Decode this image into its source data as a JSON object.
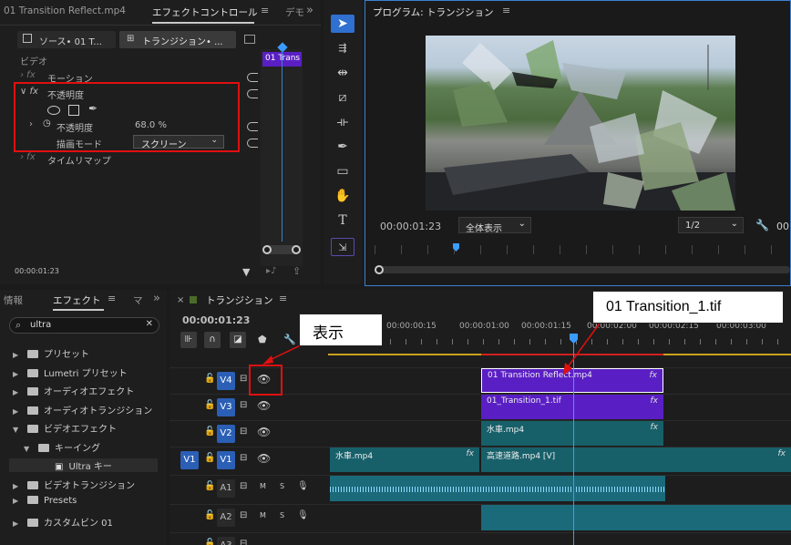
{
  "colors": {
    "accent": "#3b9cff",
    "clip_purple": "#5a1fc4",
    "clip_teal": "#17606a",
    "highlight": "#e01010"
  },
  "topbar": {
    "source_tab": "01 Transition Reflect.mp4",
    "effect_controls_tab": "エフェクトコントロール",
    "extra_tab": "デモ",
    "overflow": "»",
    "program_tab": "プログラム: トランジション"
  },
  "effect_controls": {
    "source_chip": "ソース• 01 T...",
    "sequence_chip": "トランジション• ...",
    "section_video": "ビデオ",
    "clip_label": "01 Trans",
    "motion": "モーション",
    "opacity": "不透明度",
    "opacity_prop": "不透明度",
    "opacity_value": "68.0 %",
    "blend_mode_label": "描画モード",
    "blend_mode_value": "スクリーン",
    "time_remap": "タイムリマップ",
    "timecode": "00:00:01:23",
    "fx_icon": "fx-icon"
  },
  "tools": [
    "selection-tool-icon",
    "track-select-icon",
    "ripple-edit-icon",
    "razor-tool-icon",
    "slip-tool-icon",
    "pen-tool-icon",
    "rectangle-tool-icon",
    "hand-tool-icon",
    "type-tool-icon",
    "motion-tool-icon"
  ],
  "program": {
    "timecode": "00:00:01:23",
    "zoom_value": "全体表示",
    "resolution_value": "1/2",
    "timecode_right": "00"
  },
  "project_panel": {
    "tab_info": "情報",
    "tab_effects": "エフェクト",
    "tab_more": "マ",
    "overflow": "»",
    "search_value": "ultra",
    "bins": [
      {
        "label": "プリセット",
        "indent": 0,
        "open": false
      },
      {
        "label": "Lumetri プリセット",
        "indent": 0,
        "open": false
      },
      {
        "label": "オーディオエフェクト",
        "indent": 0,
        "open": false
      },
      {
        "label": "オーディオトランジション",
        "indent": 0,
        "open": false
      },
      {
        "label": "ビデオエフェクト",
        "indent": 0,
        "open": true
      },
      {
        "label": "キーイング",
        "indent": 1,
        "open": true
      },
      {
        "label": "Ultra キー",
        "indent": 2,
        "open": false
      },
      {
        "label": "ビデオトランジション",
        "indent": 0,
        "open": false
      },
      {
        "label": "Presets",
        "indent": 0,
        "open": false
      },
      {
        "label": "カスタムビン 01",
        "indent": 0,
        "open": false
      }
    ]
  },
  "timeline": {
    "tab": "トランジション",
    "timecode": "00:00:01:23",
    "ruler": [
      "00:00:00:15",
      "00:00:01:00",
      "00:00:01:15",
      "00:00:02:00",
      "00:00:02:15",
      "00:00:03:00"
    ],
    "tracks": [
      {
        "name": "V4",
        "clips": [
          {
            "label": "01 Transition Reflect.mp4",
            "fx": "fx"
          }
        ]
      },
      {
        "name": "V3",
        "clips": [
          {
            "label": "01_Transition_1.tif",
            "fx": "fx"
          }
        ]
      },
      {
        "name": "V2",
        "clips": [
          {
            "label": "水車.mp4",
            "fx": "fx"
          }
        ]
      },
      {
        "name": "V1",
        "clips": [
          {
            "label": "水車.mp4",
            "fx": "fx"
          },
          {
            "label": "高速道路.mp4 [V]",
            "fx": "fx"
          }
        ]
      },
      {
        "name": "A1",
        "m": "M",
        "s": "S"
      },
      {
        "name": "A2",
        "m": "M",
        "s": "S"
      },
      {
        "name": "A3"
      }
    ],
    "v1_source": "V1"
  },
  "annotations": {
    "show_label": "表示",
    "file_label": "01 Transition_1.tif"
  }
}
